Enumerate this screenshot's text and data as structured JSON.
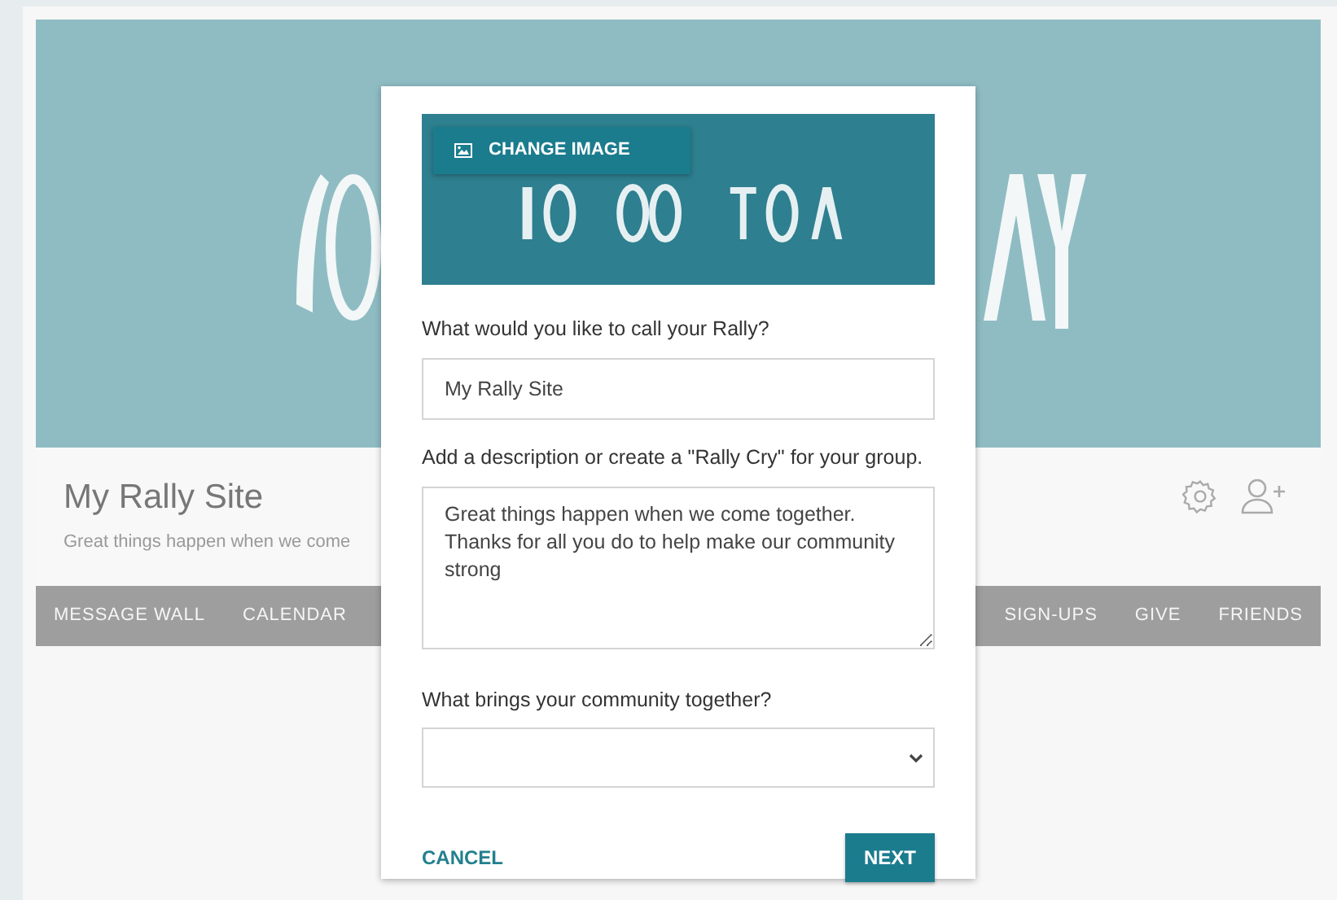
{
  "site": {
    "title": "My Rally Site",
    "subtitle": "Great things happen when we come",
    "nav_left": [
      "MESSAGE WALL",
      "CALENDAR"
    ],
    "nav_right": [
      "SIGN-UPS",
      "GIVE",
      "FRIENDS"
    ]
  },
  "modal": {
    "change_image_button": "CHANGE IMAGE",
    "fields": [
      {
        "kind": "text",
        "label": "What would you like to call your Rally?",
        "value": "My Rally Site"
      },
      {
        "kind": "textarea",
        "label": "Add a description or create a \"Rally Cry\" for your group.",
        "value": "Great things happen when we come together. Thanks for all you do to help make our community strong"
      },
      {
        "kind": "select",
        "label": "What brings your community together?"
      }
    ],
    "cancel_button": "CANCEL",
    "next_button": "NEXT"
  }
}
